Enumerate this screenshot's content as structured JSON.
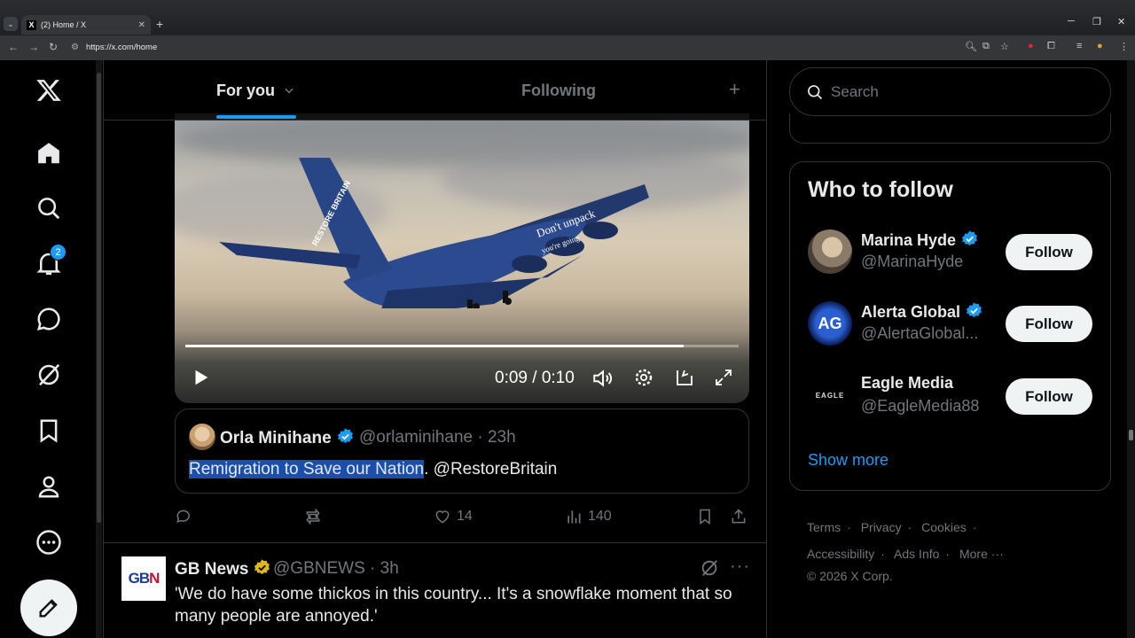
{
  "browser": {
    "tab_title": "(2) Home / X",
    "favicon": "X",
    "url": "https://x.com/home"
  },
  "nav": {
    "notification_count": "2",
    "items": [
      "home-icon",
      "explore-icon",
      "notifications-icon",
      "messages-icon",
      "grok-icon",
      "bookmarks-icon",
      "profile-icon",
      "more-icon"
    ]
  },
  "feed": {
    "tab_for_you": "For you",
    "tab_following": "Following"
  },
  "video": {
    "time": "0:09 / 0:10",
    "progress": 0.9,
    "tail_text": "Don't unpack",
    "tail_text2": "you're going",
    "tail_logo": "RESTORE BRITAIN"
  },
  "quote": {
    "name": "Orla Minihane",
    "handle": "@orlaminihane · 23h",
    "text_highlight": "Remigration to Save our Nation",
    "text_rest": ". @RestoreBritain"
  },
  "actions": {
    "likes": "14",
    "views": "140"
  },
  "tweet2": {
    "name": "GB News",
    "handle": "@GBNEWS · 3h",
    "text": "'We do have some thickos in this country... It's a snowflake moment that so many people are annoyed.'",
    "avatar_logo_g": "GB",
    "avatar_logo_n": "N"
  },
  "right": {
    "search_placeholder": "Search",
    "wtf_title": "Who to follow",
    "accounts": [
      {
        "name": "Marina Hyde",
        "handle": "@MarinaHyde",
        "button": "Follow"
      },
      {
        "name": "Alerta Global",
        "handle": "@AlertaGlobal...",
        "button": "Follow",
        "avatar_text": "AG"
      },
      {
        "name": "Eagle Media",
        "handle": "@EagleMedia88",
        "button": "Follow",
        "avatar_text": "EAGLE"
      }
    ],
    "show_more": "Show more",
    "footer": {
      "terms": "Terms",
      "privacy": "Privacy",
      "cookies": "Cookies",
      "accessibility": "Accessibility",
      "ads_info": "Ads Info",
      "more": "More ···",
      "copyright": "© 2026 X Corp."
    }
  },
  "colors": {
    "accent": "#1d9bf0",
    "verified_blue": "#1d9bf0",
    "verified_gold": "#e2b719"
  }
}
